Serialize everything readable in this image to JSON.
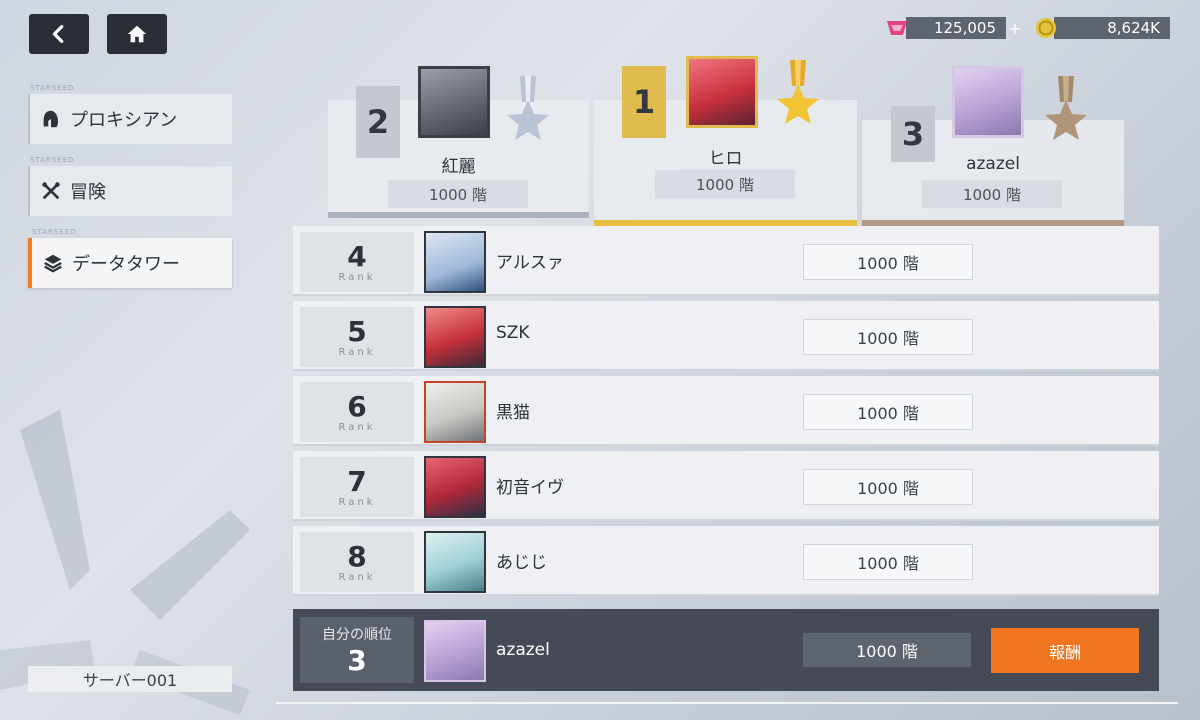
{
  "header": {
    "back_icon": "chevron-left-icon",
    "home_icon": "home-icon",
    "gems": {
      "icon": "gem-icon",
      "value": "125,005",
      "plus": "+"
    },
    "coins": {
      "icon": "coin-icon",
      "value": "8,624K"
    }
  },
  "sidebar": {
    "tag": "STARSEED",
    "items": [
      {
        "label": "プロキシアン",
        "icon": "helmet-icon",
        "active": false
      },
      {
        "label": "冒険",
        "icon": "crossed-swords-icon",
        "active": false
      },
      {
        "label": "データタワー",
        "icon": "layers-icon",
        "active": true
      }
    ],
    "server": "サーバー001"
  },
  "podium": [
    {
      "rank": "2",
      "name": "紅麗",
      "floor": "1000 階",
      "medal": "silver"
    },
    {
      "rank": "1",
      "name": "ヒロ",
      "floor": "1000 階",
      "medal": "gold"
    },
    {
      "rank": "3",
      "name": "azazel",
      "floor": "1000 階",
      "medal": "bronze"
    }
  ],
  "rank_label": "Rank",
  "rows": [
    {
      "rank": "4",
      "name": "アルスァ",
      "floor": "1000 階"
    },
    {
      "rank": "5",
      "name": "SZK",
      "floor": "1000 階"
    },
    {
      "rank": "6",
      "name": "黒猫",
      "floor": "1000 階"
    },
    {
      "rank": "7",
      "name": "初音イヴ",
      "floor": "1000 階"
    },
    {
      "rank": "8",
      "name": "あじじ",
      "floor": "1000 階"
    }
  ],
  "my_rank": {
    "label": "自分の順位",
    "rank": "3",
    "name": "azazel",
    "floor": "1000 階",
    "reward_button": "報酬"
  },
  "colors": {
    "accent": "#f07520",
    "gold": "#e0bc4e",
    "silver": "#b9c3d3",
    "bronze": "#a38a6e",
    "dark": "#454a56"
  }
}
